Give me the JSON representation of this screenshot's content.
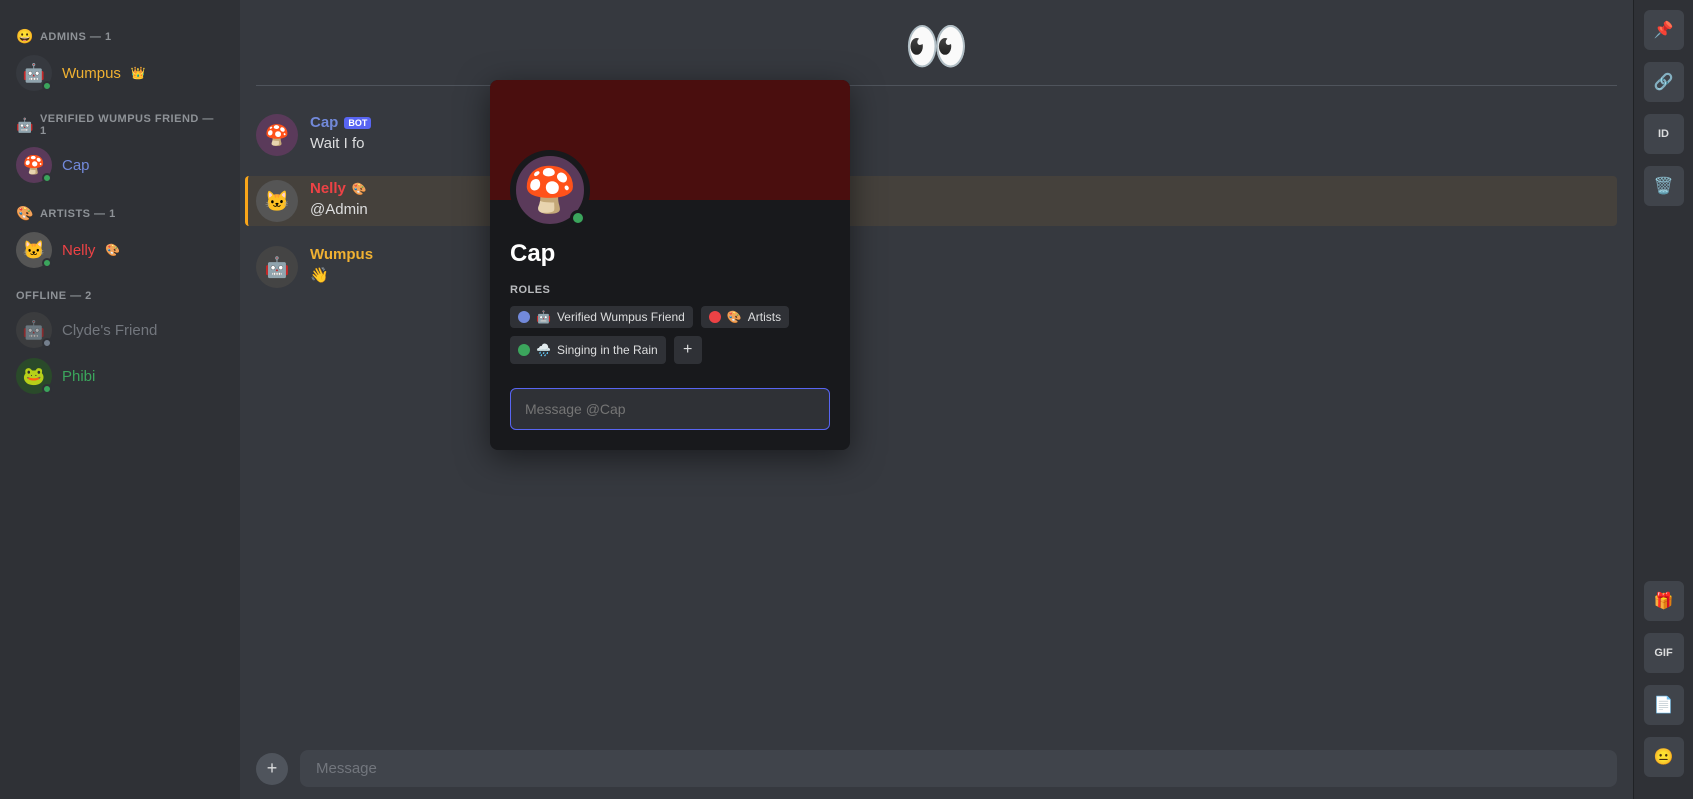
{
  "sidebar": {
    "sections": [
      {
        "id": "admins",
        "label": "ADMINS — 1",
        "icon": "😀",
        "members": [
          {
            "id": "wumpus",
            "name": "Wumpus",
            "nameClass": "name-wumpus",
            "status": "online",
            "hasCrown": true,
            "avatar": "🤖"
          }
        ]
      },
      {
        "id": "verified",
        "label": "VERIFIED WUMPUS FRIEND — 1",
        "icon": "🤖",
        "members": [
          {
            "id": "cap",
            "name": "Cap",
            "nameClass": "name-cap",
            "status": "online",
            "avatar": "🍄"
          }
        ]
      },
      {
        "id": "artists",
        "label": "ARTISTS — 1",
        "icon": "🎨",
        "members": [
          {
            "id": "nelly",
            "name": "Nelly",
            "nameClass": "name-nelly",
            "status": "online",
            "hasPalette": true,
            "avatar": "🐱"
          }
        ]
      },
      {
        "id": "offline",
        "label": "OFFLINE — 2",
        "members": [
          {
            "id": "clyde",
            "name": "Clyde's Friend",
            "nameClass": "name-offline",
            "status": "offline",
            "avatar": "🤖"
          },
          {
            "id": "phibi",
            "name": "Phibi",
            "nameClass": "name-phibi",
            "status": "online",
            "avatar": "🐸"
          }
        ]
      }
    ]
  },
  "chat": {
    "messages": [
      {
        "id": "msg1",
        "author": "Cap",
        "authorClass": "msg-author-cap",
        "hasBot": true,
        "text": "Wait I fo",
        "avatar": "🍄"
      },
      {
        "id": "msg2",
        "author": "Nelly",
        "authorClass": "msg-author-nelly",
        "hasPalette": true,
        "text": "@Admin",
        "highlighted": true,
        "avatar": "🐱"
      },
      {
        "id": "msg3",
        "author": "Wumpus",
        "authorClass": "msg-author-wumpus",
        "text": "👋",
        "avatar": "🤖"
      }
    ],
    "input_placeholder": "Message"
  },
  "profile_popup": {
    "username": "Cap",
    "roles_label": "ROLES",
    "roles": [
      {
        "id": "verified-wumpus",
        "dot_class": "role-dot-blue",
        "icon": "🤖",
        "label": "Verified Wumpus Friend"
      },
      {
        "id": "artists",
        "dot_class": "role-dot-red",
        "icon": "🎨",
        "label": "Artists"
      },
      {
        "id": "singing-rain",
        "dot_class": "role-dot-green",
        "icon": "🌧️",
        "label": "Singing in the Rain"
      }
    ],
    "message_placeholder": "Message @Cap",
    "status": "online"
  },
  "toolbar": {
    "pin_icon": "📌",
    "link_icon": "🔗",
    "id_icon": "ID",
    "delete_icon": "🗑",
    "gift_icon": "🎁",
    "gif_label": "GIF",
    "sticker_icon": "📄",
    "emoji_icon": "😐"
  }
}
